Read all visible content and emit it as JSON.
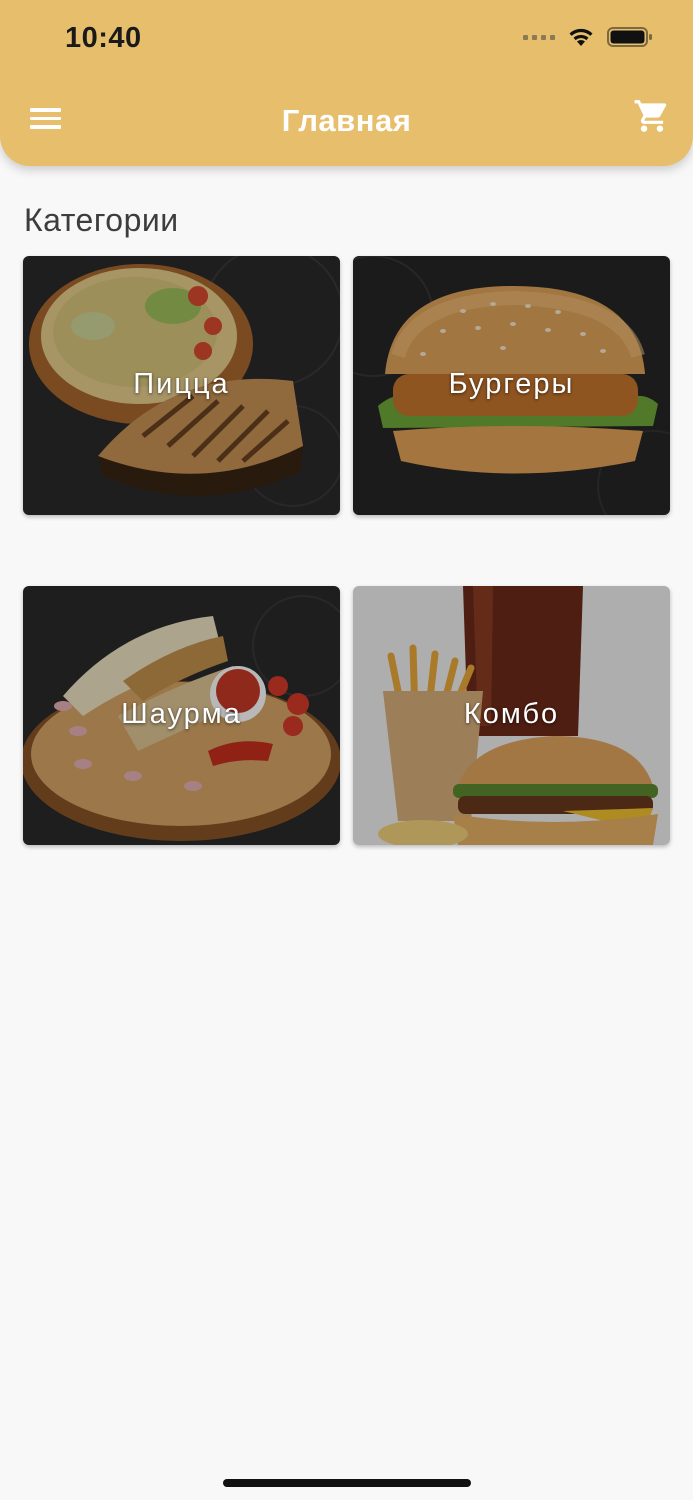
{
  "status_bar": {
    "time": "10:40"
  },
  "app_bar": {
    "title": "Главная",
    "menu_icon": "hamburger-menu-icon",
    "cart_icon": "shopping-cart-icon",
    "background_color": "#e7bf6c"
  },
  "main": {
    "section_title": "Категории",
    "categories": [
      {
        "label": "Пицца"
      },
      {
        "label": "Бургеры"
      },
      {
        "label": "Шаурма"
      },
      {
        "label": "Комбо"
      }
    ]
  }
}
